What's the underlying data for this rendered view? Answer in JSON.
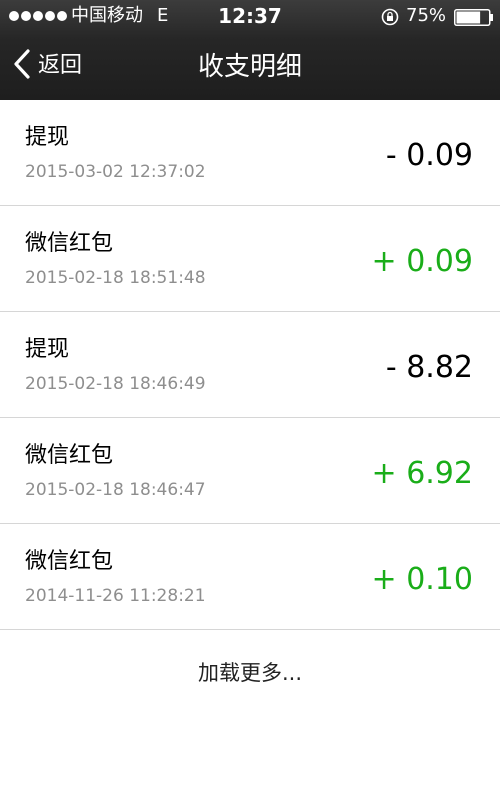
{
  "status_bar": {
    "carrier": "中国移动",
    "network": "E",
    "time": "12:37",
    "battery_percent": "75%",
    "battery_level": 0.75,
    "icons": [
      "signal-dots-icon",
      "rotation-lock-icon",
      "battery-icon"
    ]
  },
  "nav": {
    "back_label": "返回",
    "title": "收支明细",
    "back_icon": "chevron-left-icon"
  },
  "transactions": [
    {
      "title": "提现",
      "date": "2015-03-02 12:37:02",
      "amount": "- 0.09",
      "type": "expense"
    },
    {
      "title": "微信红包",
      "date": "2015-02-18 18:51:48",
      "amount": "+ 0.09",
      "type": "income"
    },
    {
      "title": "提现",
      "date": "2015-02-18 18:46:49",
      "amount": "- 8.82",
      "type": "expense"
    },
    {
      "title": "微信红包",
      "date": "2015-02-18 18:46:47",
      "amount": "+ 6.92",
      "type": "income"
    },
    {
      "title": "微信红包",
      "date": "2014-11-26 11:28:21",
      "amount": "+ 0.10",
      "type": "income"
    }
  ],
  "load_more_label": "加载更多...",
  "colors": {
    "header_bg": "#262626",
    "income": "#1aad19",
    "expense": "#000000",
    "date_text": "#8e8e8e",
    "divider": "#d6d6d6"
  }
}
